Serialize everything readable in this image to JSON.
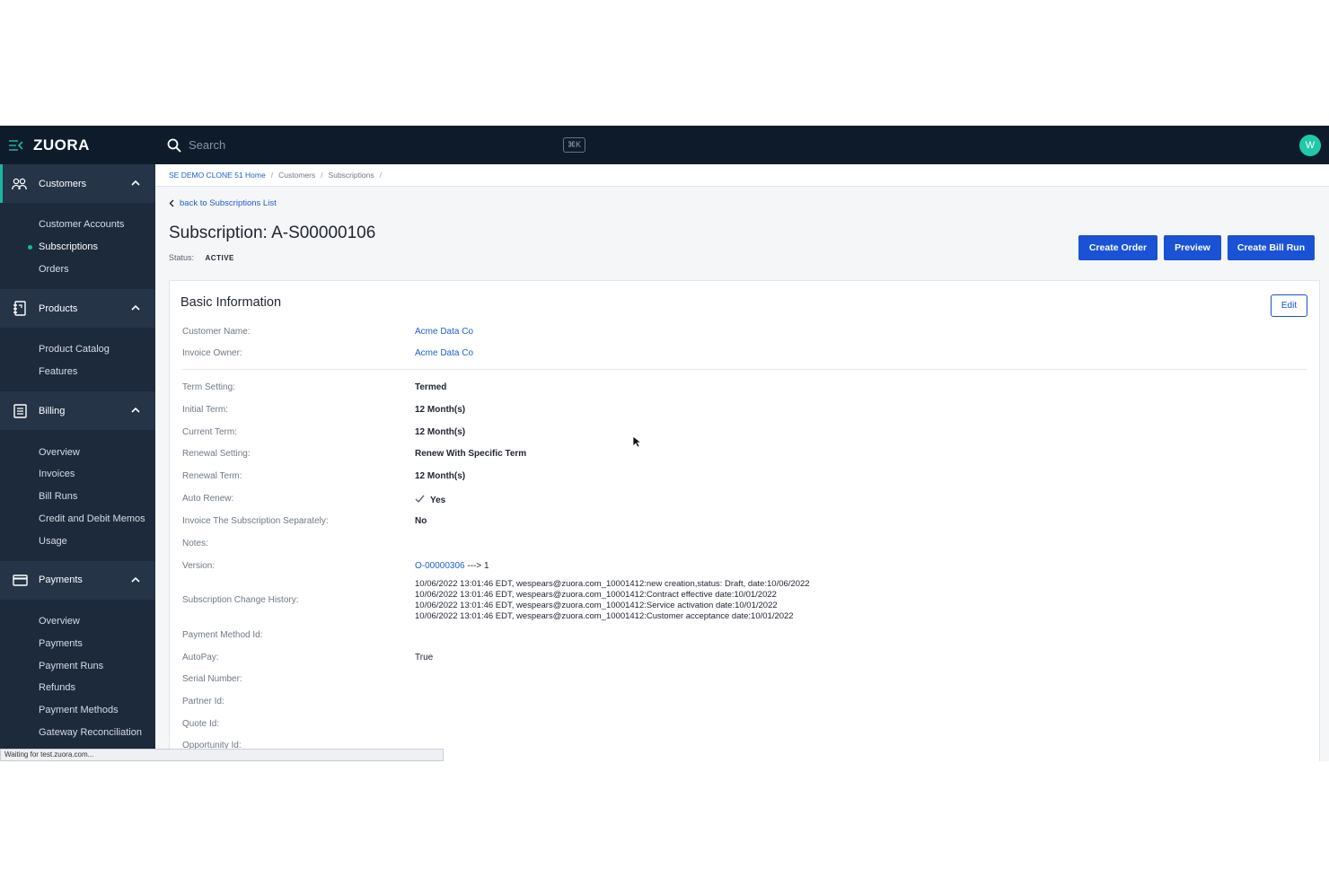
{
  "brand": {
    "logo": "ZUORA"
  },
  "search": {
    "placeholder": "Search",
    "shortcut": "⌘K"
  },
  "user": {
    "avatar_initial": "W"
  },
  "sidebar": {
    "sections": [
      {
        "label": "Customers",
        "icon": "people-icon",
        "items": [
          "Customer Accounts",
          "Subscriptions",
          "Orders"
        ],
        "current": "Subscriptions"
      },
      {
        "label": "Products",
        "icon": "catalog-icon",
        "items": [
          "Product Catalog",
          "Features"
        ]
      },
      {
        "label": "Billing",
        "icon": "document-icon",
        "items": [
          "Overview",
          "Invoices",
          "Bill Runs",
          "Credit and Debit Memos",
          "Usage"
        ]
      },
      {
        "label": "Payments",
        "icon": "card-icon",
        "items": [
          "Overview",
          "Payments",
          "Payment Runs",
          "Refunds",
          "Payment Methods",
          "Gateway Reconciliation"
        ]
      }
    ]
  },
  "statusbar": {
    "text": "Waiting for test.zuora.com..."
  },
  "breadcrumb": {
    "home": "SE DEMO CLONE 51 Home",
    "customers": "Customers",
    "subscriptions": "Subscriptions",
    "separator": "/"
  },
  "page": {
    "back_label": "back to Subscriptions List",
    "title": "Subscription: A-S00000106",
    "status_label": "Status:",
    "status_value": "ACTIVE"
  },
  "actions": {
    "create_order": "Create Order",
    "preview": "Preview",
    "create_bill_run": "Create Bill Run"
  },
  "basic_info": {
    "title": "Basic Information",
    "edit_label": "Edit",
    "customer_name": {
      "label": "Customer Name:",
      "value": "Acme Data Co"
    },
    "invoice_owner": {
      "label": "Invoice Owner:",
      "value": "Acme Data Co"
    },
    "term_setting": {
      "label": "Term Setting:",
      "value": "Termed"
    },
    "initial_term": {
      "label": "Initial Term:",
      "value": "12 Month(s)"
    },
    "current_term": {
      "label": "Current Term:",
      "value": "12 Month(s)"
    },
    "renewal_setting": {
      "label": "Renewal Setting:",
      "value": "Renew With Specific Term"
    },
    "renewal_term": {
      "label": "Renewal Term:",
      "value": "12 Month(s)"
    },
    "auto_renew": {
      "label": "Auto Renew:",
      "value": "Yes"
    },
    "invoice_separately": {
      "label": "Invoice The Subscription Separately:",
      "value": "No"
    },
    "notes": {
      "label": "Notes:",
      "value": ""
    },
    "version": {
      "label": "Version:",
      "order_link": "O-00000306",
      "suffix": " ---> 1"
    },
    "change_history": {
      "label": "Subscription Change History:",
      "lines": [
        "10/06/2022 13:01:46 EDT, wespears@zuora.com_10001412:new creation,status: Draft, date:10/06/2022",
        "10/06/2022 13:01:46 EDT, wespears@zuora.com_10001412:Contract effective date:10/01/2022",
        "10/06/2022 13:01:46 EDT, wespears@zuora.com_10001412:Service activation date:10/01/2022",
        "10/06/2022 13:01:46 EDT, wespears@zuora.com_10001412:Customer acceptance date:10/01/2022"
      ]
    },
    "payment_method_id": {
      "label": "Payment Method Id:",
      "value": ""
    },
    "autopay": {
      "label": "AutoPay:",
      "value": "True"
    },
    "serial_number": {
      "label": "Serial Number:",
      "value": ""
    },
    "partner_id": {
      "label": "Partner Id:",
      "value": ""
    },
    "quote_id": {
      "label": "Quote Id:",
      "value": ""
    },
    "opportunity_id": {
      "label": "Opportunity Id:",
      "value": ""
    }
  }
}
